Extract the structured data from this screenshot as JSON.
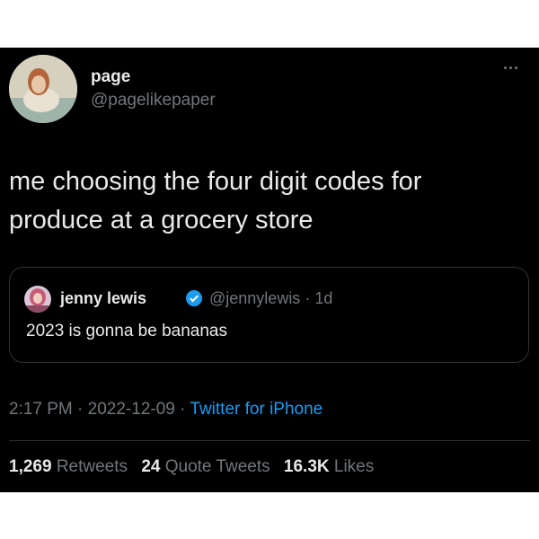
{
  "author": {
    "name": "page",
    "handle": "@pagelikepaper"
  },
  "tweet_text": "me choosing the four digit codes for produce at a grocery store",
  "quoted_tweet": {
    "name": "jenny lewis",
    "handle": "@jennylewis",
    "time_ago": "1d",
    "text": "2023 is gonna be bananas"
  },
  "meta": {
    "time": "2:17 PM",
    "date": "2022-12-09",
    "source": "Twitter for iPhone"
  },
  "stats": {
    "retweets_count": "1,269",
    "retweets_label": "Retweets",
    "quotes_count": "24",
    "quotes_label": "Quote Tweets",
    "likes_count": "16.3K",
    "likes_label": "Likes"
  },
  "colors": {
    "background": "#000000",
    "text": "#e7e9ea",
    "secondary": "#71767b",
    "link": "#1d9bf0",
    "verified": "#1d9bf0"
  }
}
